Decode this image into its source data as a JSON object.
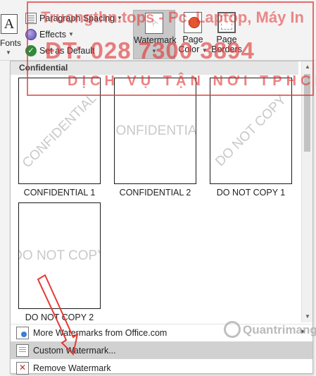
{
  "ribbon": {
    "fonts_glyph": "A",
    "fonts_label": "Fonts",
    "paragraph_spacing": "Paragraph Spacing",
    "effects": "Effects",
    "set_default": "Set as Default",
    "watermark": "Watermark",
    "page_color_1": "Page",
    "page_color_2": "Color",
    "page_borders_1": "Page",
    "page_borders_2": "Borders"
  },
  "gallery": {
    "group_header": "Confidential",
    "thumbnails": [
      {
        "text": "CONFIDENTIAL",
        "caption": "CONFIDENTIAL 1",
        "style": "diagonal"
      },
      {
        "text": "CONFIDENTIAL",
        "caption": "CONFIDENTIAL 2",
        "style": "horizontal"
      },
      {
        "text": "DO NOT COPY",
        "caption": "DO NOT COPY 1",
        "style": "diagonal"
      },
      {
        "text": "DO NOT COPY",
        "caption": "DO NOT COPY 2",
        "style": "horizontal"
      }
    ]
  },
  "commands": {
    "more": "More Watermarks from Office.com",
    "custom": "Custom Watermark...",
    "remove": "Remove Watermark"
  },
  "overlay": {
    "stamp_line1": "Truongthn.tops - Pc, Laptop, Máy In",
    "stamp_line2": "ĐT: 028 7300 3894",
    "stamp_line3": "DỊCH VỤ TẬN NƠI TPHCM",
    "brand": "Quantrimang",
    "stamp_color": "#e02d2d",
    "arrow_color": "#e53935"
  }
}
